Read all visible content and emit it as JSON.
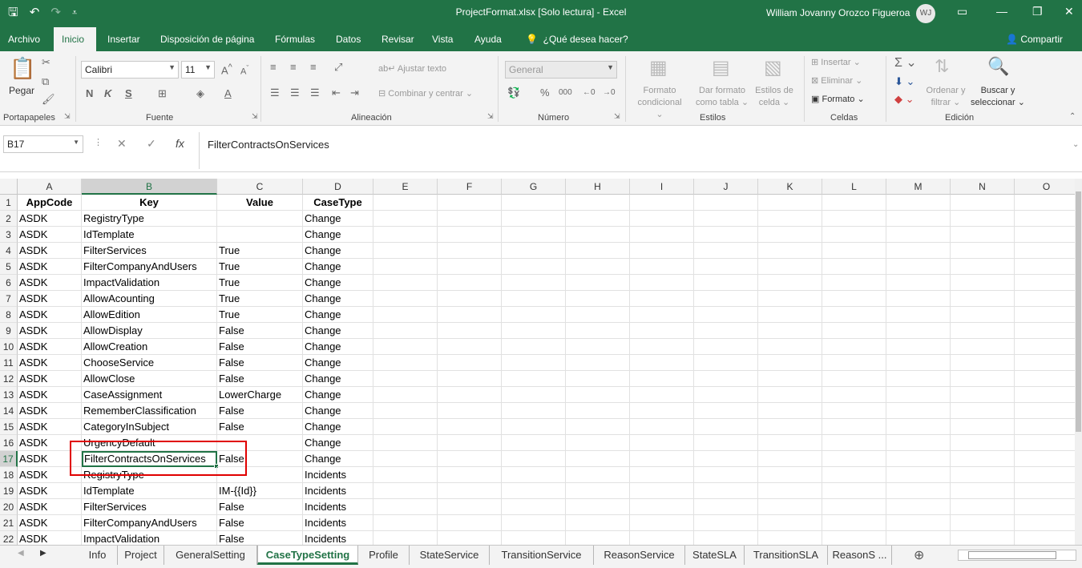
{
  "titlebar": {
    "doc_title": "ProjectFormat.xlsx  [Solo lectura]  -  Excel",
    "user_name": "William Jovanny Orozco Figueroa",
    "avatar_initials": "WJ",
    "icons": [
      "save-icon",
      "undo-icon",
      "redo-icon",
      "customize-qat-icon",
      "ribbon-display-icon",
      "minimize-icon",
      "restore-icon",
      "close-icon"
    ]
  },
  "ribbon_tabs": [
    "Archivo",
    "Inicio",
    "Insertar",
    "Disposición de página",
    "Fórmulas",
    "Datos",
    "Revisar",
    "Vista",
    "Ayuda"
  ],
  "tell_me": "¿Qué desea hacer?",
  "share_label": "Compartir",
  "ribbon": {
    "paste_label": "Pegar",
    "font_name": "Calibri",
    "font_size": "11",
    "bold": "N",
    "italic": "K",
    "underline": "S",
    "wrap_text": "Ajustar texto",
    "merge_center": "Combinar y centrar",
    "number_format": "General",
    "cond_format_1": "Formato",
    "cond_format_2": "condicional",
    "format_table_1": "Dar formato",
    "format_table_2": "como tabla",
    "cell_styles_1": "Estilos de",
    "cell_styles_2": "celda",
    "insert": "Insertar",
    "delete": "Eliminar",
    "format": "Formato",
    "sort_1": "Ordenar y",
    "sort_2": "filtrar",
    "find_1": "Buscar y",
    "find_2": "seleccionar",
    "groups": {
      "clipboard": "Portapapeles",
      "font": "Fuente",
      "alignment": "Alineación",
      "number": "Número",
      "styles": "Estilos",
      "cells": "Celdas",
      "editing": "Edición"
    }
  },
  "formula_bar": {
    "name_box": "B17",
    "formula": "FilterContractsOnServices",
    "fx": "fx"
  },
  "columns": [
    "A",
    "B",
    "C",
    "D",
    "E",
    "F",
    "G",
    "H",
    "I",
    "J",
    "K",
    "L",
    "M",
    "N",
    "O"
  ],
  "rows": [
    {
      "n": "1",
      "a": "AppCode",
      "b": "Key",
      "c": "Value",
      "d": "CaseType"
    },
    {
      "n": "2",
      "a": "ASDK",
      "b": "RegistryType",
      "c": "",
      "d": "Change"
    },
    {
      "n": "3",
      "a": "ASDK",
      "b": "IdTemplate",
      "c": "",
      "d": "Change"
    },
    {
      "n": "4",
      "a": "ASDK",
      "b": "FilterServices",
      "c": "True",
      "d": "Change"
    },
    {
      "n": "5",
      "a": "ASDK",
      "b": "FilterCompanyAndUsers",
      "c": "True",
      "d": "Change"
    },
    {
      "n": "6",
      "a": "ASDK",
      "b": "ImpactValidation",
      "c": "True",
      "d": "Change"
    },
    {
      "n": "7",
      "a": "ASDK",
      "b": "AllowAcounting",
      "c": "True",
      "d": "Change"
    },
    {
      "n": "8",
      "a": "ASDK",
      "b": "AllowEdition",
      "c": "True",
      "d": "Change"
    },
    {
      "n": "9",
      "a": "ASDK",
      "b": "AllowDisplay",
      "c": "False",
      "d": "Change"
    },
    {
      "n": "10",
      "a": "ASDK",
      "b": "AllowCreation",
      "c": "False",
      "d": "Change"
    },
    {
      "n": "11",
      "a": "ASDK",
      "b": "ChooseService",
      "c": "False",
      "d": "Change"
    },
    {
      "n": "12",
      "a": "ASDK",
      "b": "AllowClose",
      "c": "False",
      "d": "Change"
    },
    {
      "n": "13",
      "a": "ASDK",
      "b": "CaseAssignment",
      "c": "LowerCharge",
      "d": "Change"
    },
    {
      "n": "14",
      "a": "ASDK",
      "b": "RememberClassification",
      "c": "False",
      "d": "Change"
    },
    {
      "n": "15",
      "a": "ASDK",
      "b": "CategoryInSubject",
      "c": "False",
      "d": "Change"
    },
    {
      "n": "16",
      "a": "ASDK",
      "b": "UrgencyDefault",
      "c": "",
      "d": "Change"
    },
    {
      "n": "17",
      "a": "ASDK",
      "b": "FilterContractsOnServices",
      "c": "False",
      "d": "Change"
    },
    {
      "n": "18",
      "a": "ASDK",
      "b": "RegistryType",
      "c": "",
      "d": "Incidents"
    },
    {
      "n": "19",
      "a": "ASDK",
      "b": "IdTemplate",
      "c": "IM-{{Id}}",
      "d": "Incidents"
    },
    {
      "n": "20",
      "a": "ASDK",
      "b": "FilterServices",
      "c": "False",
      "d": "Incidents"
    },
    {
      "n": "21",
      "a": "ASDK",
      "b": "FilterCompanyAndUsers",
      "c": "False",
      "d": "Incidents"
    },
    {
      "n": "22",
      "a": "ASDK",
      "b": "ImpactValidation",
      "c": "False",
      "d": "Incidents"
    }
  ],
  "active_cell": "B17",
  "sheet_tabs": [
    "Info",
    "Project",
    "GeneralSetting",
    "CaseTypeSetting",
    "Profile",
    "StateService",
    "TransitionService",
    "ReasonService",
    "StateSLA",
    "TransitionSLA",
    "ReasonS ..."
  ],
  "active_sheet": "CaseTypeSetting",
  "accent_color": "#217346"
}
